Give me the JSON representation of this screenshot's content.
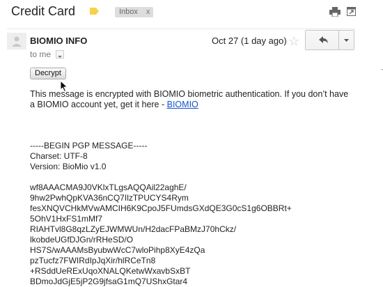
{
  "header": {
    "subject": "Credit Card",
    "label_chip": "Inbox",
    "label_chip_close": "x",
    "label_color": "#f7d14a",
    "tools": {
      "print_icon": "print-icon",
      "new_window_icon": "new-window-icon"
    }
  },
  "message": {
    "sender": "BIOMIO INFO",
    "date": "Oct 27 (1 day ago)",
    "to": "to me",
    "decrypt_label": "Decrypt",
    "notice": "This message is encrypted with BIOMIO biometric authentication. If you don’t have a BIOMIO account yet, get it here - ",
    "notice_link": "BIOMIO",
    "link_color": "#1155cc",
    "pgp_header": [
      "-----BEGIN PGP MESSAGE-----",
      "Charset: UTF-8",
      "Version: BioMio v1.0"
    ],
    "pgp_body": [
      "wf8AAACMA9J0VKlxTLgsAQQAil22aghE/",
      "9hw2PwhQpKVA36nCQ7IlzTPUCYS4Rym",
      "fesXNQVCHkMVwAMCIH6K9CpoJ5FUmdsGXdQE3G0cS1g6OBBRt+",
      "5OhV1HxFS1mMf7",
      "RIAHTvl8G8qzLZyEJWMWUn/H2dacFPaBMzJ70hCkz/",
      "lkobdeUGfDJGn/rRHeSD/O",
      "HS7S/wAAAMsByubwWcC7wloPihp8XyE4zQa",
      "pzTucfz7FWIRdIpJqXir/hlRCeTn8",
      "+RSddUeRExUqoXNALQKetwWxavbSxBT",
      "BDmoJdGjE5jP2G9jfsaG1mQ7UShxGtar4"
    ]
  }
}
